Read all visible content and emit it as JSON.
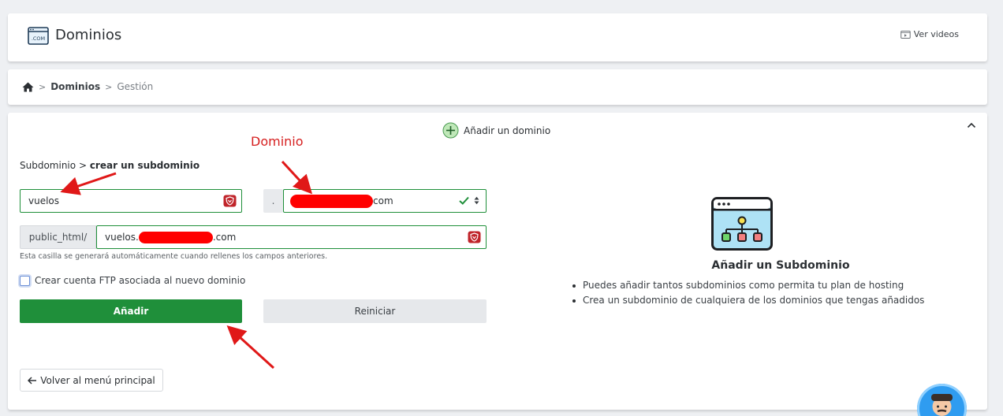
{
  "header": {
    "logo_text": ".COM",
    "title": "Dominios",
    "videos_label": "Ver videos"
  },
  "breadcrumb": {
    "item1": "Dominios",
    "item2": "Gestión"
  },
  "main": {
    "add_domain_label": "Añadir un dominio",
    "annotation_label": "Dominio",
    "form_crumb_root": "Subdominio",
    "form_crumb_current": "crear un subdominio",
    "subdomain_value": "vuelos",
    "dot": ".",
    "domain_suffix": "com",
    "path_prefix": "public_html/",
    "path_value_start": "vuelos.",
    "path_value_end": ".com",
    "helper_text": "Esta casilla se generará automáticamente cuando rellenes los campos anteriores.",
    "ftp_label": "Crear cuenta FTP asociada al nuevo dominio",
    "add_button": "Añadir",
    "reset_button": "Reiniciar",
    "back_button": "Volver al menú principal"
  },
  "info": {
    "title": "Añadir un Subdominio",
    "bullets": [
      "Puedes añadir tantos subdominios como permita tu plan de hosting",
      "Crea un subdominio de cualquiera de los dominios que tengas añadidos"
    ]
  },
  "colors": {
    "primary_green": "#1f8f3a",
    "annotation_red": "#d62020",
    "redaction_red": "#ff0000",
    "avatar_blue": "#2f9cf0"
  }
}
